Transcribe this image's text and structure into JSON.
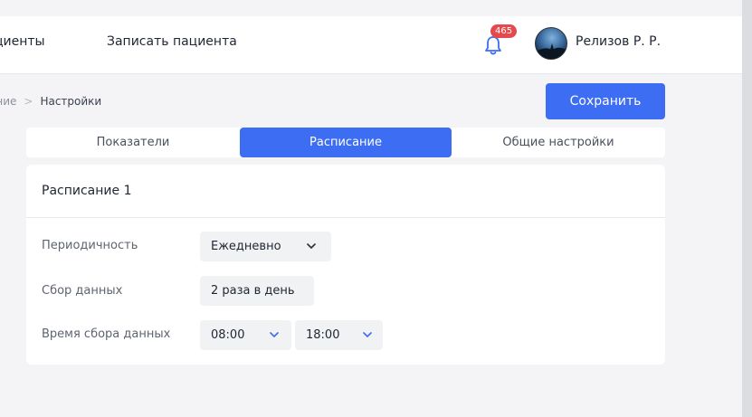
{
  "nav": {
    "patients": "циенты",
    "add_patient": "Записать пациента"
  },
  "notifications": {
    "count": "465",
    "icon": "bell-icon"
  },
  "user": {
    "name": "Релизов Р. Р.",
    "avatar": "avatar"
  },
  "breadcrumb": {
    "parent": "ание",
    "separator": ">",
    "current": "Настройки"
  },
  "actions": {
    "save": "Сохранить"
  },
  "tabs": [
    {
      "label": "Показатели",
      "active": false
    },
    {
      "label": "Расписание",
      "active": true
    },
    {
      "label": "Общие настройки",
      "active": false
    }
  ],
  "schedule": {
    "title": "Расписание 1",
    "rows": {
      "frequency": {
        "label": "Периодичность",
        "value": "Ежедневно"
      },
      "collection": {
        "label": "Сбор данных",
        "value": "2 раза в день"
      },
      "times": {
        "label": "Время сбора данных",
        "values": [
          "08:00",
          "18:00"
        ]
      }
    }
  },
  "colors": {
    "accent": "#3d6df2",
    "badge": "#e5484d"
  }
}
